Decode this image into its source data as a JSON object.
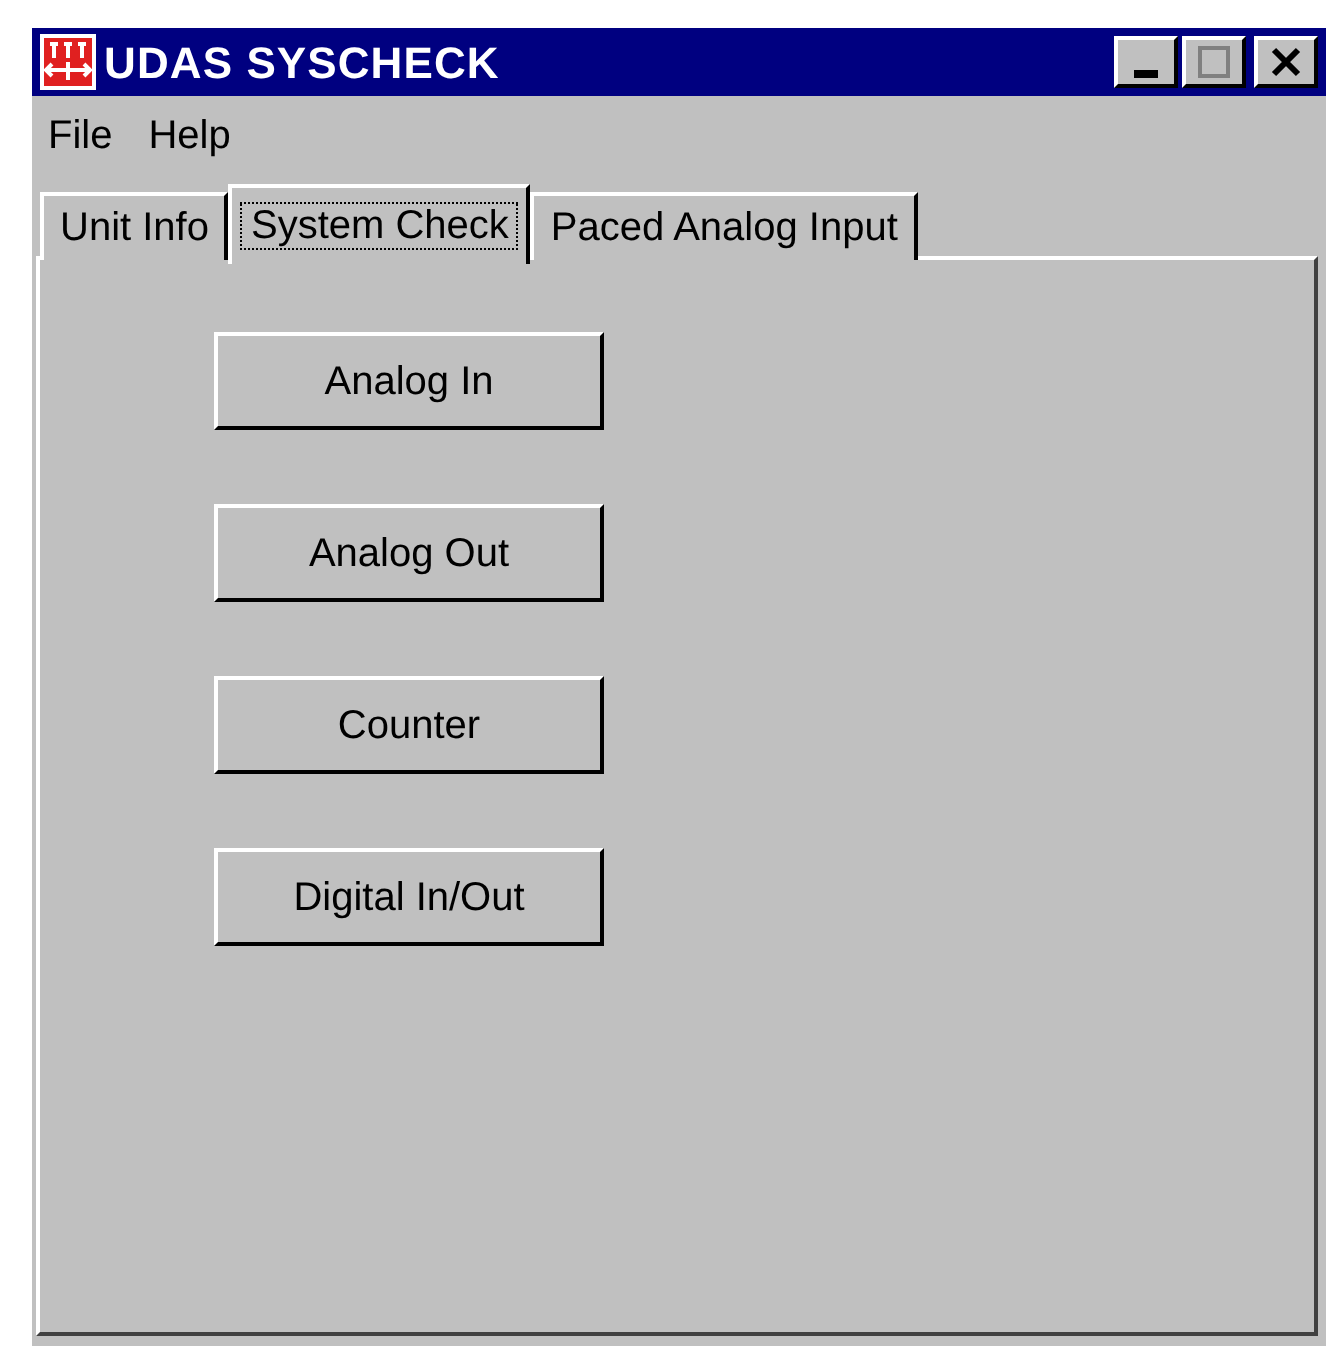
{
  "window": {
    "title": "UDAS SYSCHECK"
  },
  "menu": [
    "File",
    "Help"
  ],
  "tabs": [
    {
      "label": "Unit Info",
      "selected": false
    },
    {
      "label": "System Check",
      "selected": true
    },
    {
      "label": "Paced Analog Input",
      "selected": false
    }
  ],
  "buttons": [
    "Analog In",
    "Analog Out",
    "Counter",
    "Digital In/Out"
  ]
}
